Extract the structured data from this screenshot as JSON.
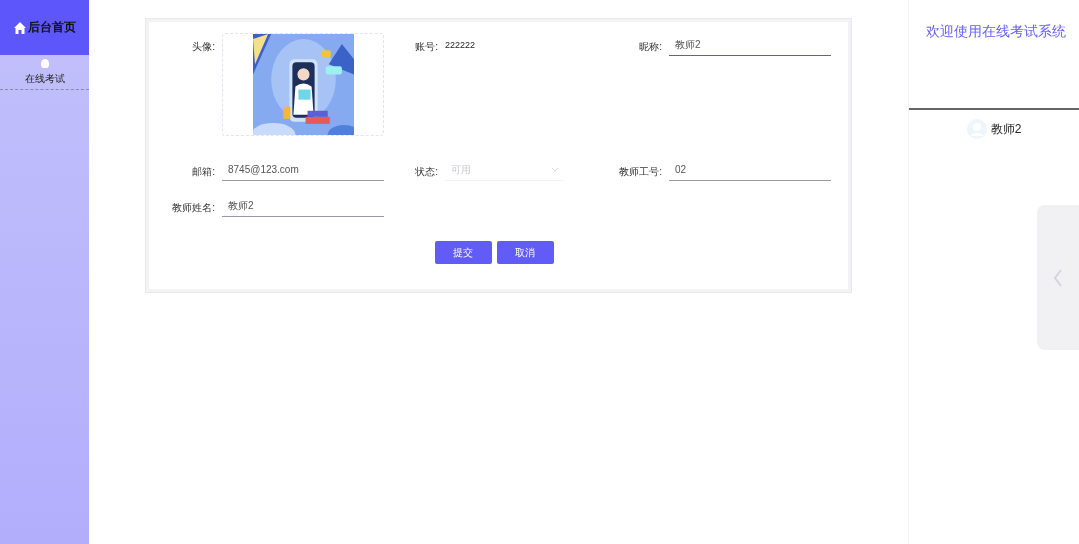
{
  "sidebar": {
    "home": "后台首页",
    "items": [
      {
        "label": "在线考试",
        "selected": false
      }
    ]
  },
  "form": {
    "fields": [
      {
        "kind": "avatar",
        "label": "头像:"
      },
      {
        "kind": "text",
        "label": "账号:",
        "value": "222222"
      },
      {
        "kind": "input",
        "label": "昵称:",
        "value": "教师2"
      },
      {
        "kind": "input",
        "label": "邮箱:",
        "value": "8745@123.com"
      },
      {
        "kind": "select",
        "label": "状态:",
        "placeholder": "可用"
      },
      {
        "kind": "input",
        "label": "教师工号:",
        "value": "02"
      },
      {
        "kind": "input",
        "label": "教师姓名:",
        "value": "教师2"
      }
    ],
    "buttons": [
      "提交",
      "取消"
    ]
  },
  "header": {
    "welcome": "欢迎使用在线考试系统",
    "user": "教师2"
  }
}
